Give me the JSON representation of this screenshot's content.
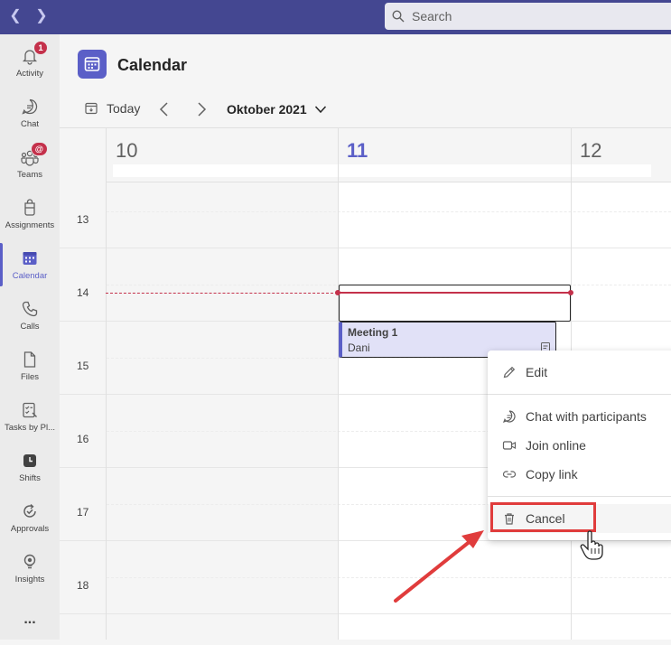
{
  "search": {
    "placeholder": "Search"
  },
  "rail": {
    "items": [
      {
        "label": "Activity",
        "badge": "1"
      },
      {
        "label": "Chat"
      },
      {
        "label": "Teams",
        "badge": "@"
      },
      {
        "label": "Assignments"
      },
      {
        "label": "Calendar"
      },
      {
        "label": "Calls"
      },
      {
        "label": "Files"
      },
      {
        "label": "Tasks by Pl..."
      },
      {
        "label": "Shifts"
      },
      {
        "label": "Approvals"
      },
      {
        "label": "Insights"
      },
      {
        "label": "..."
      }
    ]
  },
  "header": {
    "title": "Calendar"
  },
  "toolbar": {
    "today_label": "Today",
    "month_label": "Oktober 2021"
  },
  "days": [
    "10",
    "11",
    "12"
  ],
  "hours": [
    "13",
    "14",
    "15",
    "16",
    "17",
    "18"
  ],
  "event": {
    "title": "Meeting 1",
    "organizer": "Dani"
  },
  "context_menu": {
    "items": [
      "Edit",
      "Chat with participants",
      "Join online",
      "Copy link",
      "Cancel"
    ]
  },
  "colors": {
    "brand": "#5b5fc7",
    "topbar": "#444791",
    "now": "#c4314b",
    "highlight": "#e03c3c"
  }
}
